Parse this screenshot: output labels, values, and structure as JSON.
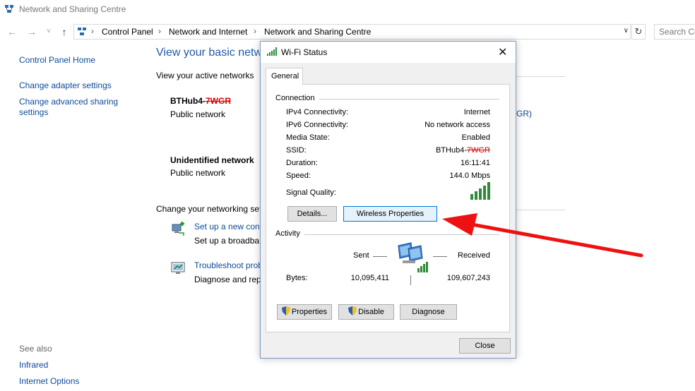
{
  "window": {
    "title": "Network and Sharing Centre",
    "icon": "network-icon"
  },
  "nav": {
    "back": "←",
    "forward": "→",
    "recent": "˅",
    "up": "↑",
    "breadcrumb": [
      "Control Panel",
      "Network and Internet",
      "Network and Sharing Centre"
    ],
    "separator": "›",
    "dropdown": "∨",
    "refresh": "↻",
    "search_placeholder": "Search Control Panel"
  },
  "sidebar": {
    "items": [
      {
        "label": "Control Panel Home"
      },
      {
        "label": "Change adapter settings"
      },
      {
        "label": "Change advanced sharing settings"
      }
    ],
    "see_also_label": "See also",
    "see_also": [
      {
        "label": "Infrared"
      },
      {
        "label": "Internet Options"
      }
    ]
  },
  "main": {
    "heading": "View your basic network information and set up connections",
    "active_networks_label": "View your active networks",
    "networks": [
      {
        "name_prefix": "BTHub4-",
        "name_redacted": "7WGR",
        "type": "Public network"
      },
      {
        "name": "Unidentified network",
        "type": "Public network"
      }
    ],
    "right_link_fragment": "GR)",
    "change_settings_label": "Change your networking settings",
    "tasks": [
      {
        "icon": "new-connection-icon",
        "link": "Set up a new connection or network",
        "desc": "Set up a broadband, dial-up or VPN connection; or set up a router or access point."
      },
      {
        "icon": "troubleshoot-icon",
        "link": "Troubleshoot problems",
        "desc": "Diagnose and repair network problems or get troubleshooting information."
      }
    ]
  },
  "dialog": {
    "title": "Wi-Fi Status",
    "close": "✕",
    "tab": "General",
    "connection_label": "Connection",
    "rows": [
      {
        "key": "IPv4 Connectivity:",
        "value": "Internet"
      },
      {
        "key": "IPv6 Connectivity:",
        "value": "No network access"
      },
      {
        "key": "Media State:",
        "value": "Enabled"
      },
      {
        "key": "SSID:",
        "value": "BTHub4-",
        "value_redacted": "7WGR"
      },
      {
        "key": "Duration:",
        "value": "16:11:41"
      },
      {
        "key": "Speed:",
        "value": "144.0 Mbps"
      }
    ],
    "signal_label": "Signal Quality:",
    "signal_bars": 5,
    "details_button": "Details...",
    "wireless_properties_button": "Wireless Properties",
    "activity_label": "Activity",
    "sent_label": "Sent",
    "received_label": "Received",
    "bytes_label": "Bytes:",
    "bytes_sent": "10,095,411",
    "bytes_received": "109,607,243",
    "properties_button": "Properties",
    "disable_button": "Disable",
    "diagnose_button": "Diagnose",
    "close_button": "Close"
  },
  "colors": {
    "link": "#0c4c9a",
    "heading": "#1f5aa6",
    "annotation_arrow": "#ee1111",
    "signal": "#2e8b3a",
    "redaction": "#d60000"
  }
}
